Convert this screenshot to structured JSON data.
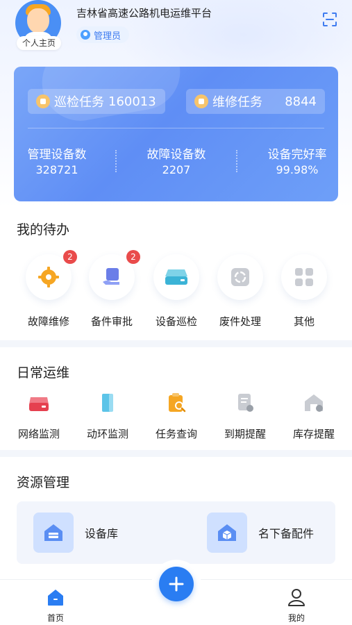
{
  "header": {
    "avatar_label": "个人主页",
    "platform_title": "吉林省高速公路机电运维平台",
    "role": "管理员",
    "scan_icon": "scan-icon"
  },
  "stats": {
    "patrol_tasks": {
      "label": "巡检任务",
      "value": "160013"
    },
    "repair_tasks": {
      "label": "维修任务",
      "value": "8844"
    },
    "items": [
      {
        "label": "管理设备数",
        "value": "328721"
      },
      {
        "label": "故障设备数",
        "value": "2207"
      },
      {
        "label": "设备完好率",
        "value": "99.98%"
      }
    ]
  },
  "todo": {
    "title": "我的待办",
    "items": [
      {
        "label": "故障维修",
        "icon": "gear-icon",
        "badge": "2"
      },
      {
        "label": "备件审批",
        "icon": "approval-icon",
        "badge": "2"
      },
      {
        "label": "设备巡检",
        "icon": "device-icon",
        "badge": ""
      },
      {
        "label": "废件处理",
        "icon": "recycle-icon",
        "badge": ""
      },
      {
        "label": "其他",
        "icon": "grid-icon",
        "badge": ""
      }
    ]
  },
  "daily": {
    "title": "日常运维",
    "items": [
      {
        "label": "网络监测",
        "icon": "network-icon"
      },
      {
        "label": "动环监测",
        "icon": "environment-icon"
      },
      {
        "label": "任务查询",
        "icon": "task-search-icon"
      },
      {
        "label": "到期提醒",
        "icon": "expiry-reminder-icon"
      },
      {
        "label": "库存提醒",
        "icon": "inventory-reminder-icon"
      }
    ]
  },
  "resources": {
    "title": "资源管理",
    "items": [
      {
        "label": "设备库",
        "icon": "warehouse-icon"
      },
      {
        "label": "名下备配件",
        "icon": "parts-box-icon"
      }
    ]
  },
  "nav": {
    "home": "首页",
    "mine": "我的"
  },
  "colors": {
    "accent": "#2a7df2",
    "badge": "#e94b4b",
    "card_gradient_start": "#7aa6f8",
    "card_gradient_end": "#5f8ef5"
  }
}
